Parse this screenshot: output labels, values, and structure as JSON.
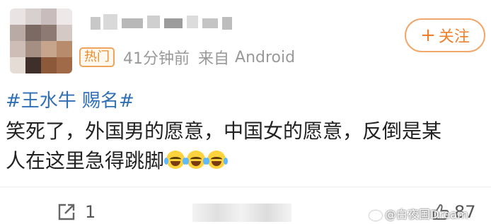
{
  "post": {
    "hot_badge": "热门",
    "time": "41分钟前",
    "source_prefix": "来自",
    "source_app": "Android",
    "follow_plus": "+",
    "follow_label": "关注",
    "topic": "#王水牛 赐名#",
    "text_line1": "笑死了，外国男的愿意，中国女的愿意，反倒是某",
    "text_line2": "人在这里急得跳脚",
    "emoji_name": "laugh-cry-emoji",
    "emoji_count": 3
  },
  "actions": {
    "repost_count": "1",
    "like_count": "87"
  },
  "watermark": {
    "text": "@白夜国Dream"
  },
  "colors": {
    "topic_link": "#2f6fb5",
    "follow_accent": "#f07f2a",
    "badge_accent": "#ef8a2a",
    "meta_gray": "#999999"
  }
}
